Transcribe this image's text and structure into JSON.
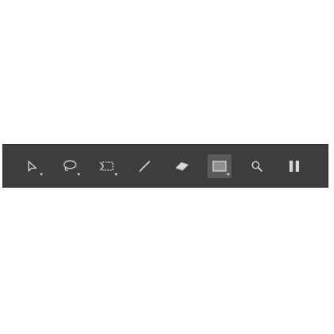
{
  "toolbar": {
    "tools": [
      {
        "id": "select",
        "icon": "arrow-select-icon",
        "has_submenu": true,
        "selected": false
      },
      {
        "id": "lasso",
        "icon": "lasso-icon",
        "has_submenu": true,
        "selected": false
      },
      {
        "id": "marquee",
        "icon": "marquee-select-icon",
        "has_submenu": true,
        "selected": false
      },
      {
        "id": "line",
        "icon": "line-icon",
        "has_submenu": false,
        "selected": false
      },
      {
        "id": "eraser",
        "icon": "eraser-icon",
        "has_submenu": false,
        "selected": false
      },
      {
        "id": "rectangle",
        "icon": "rectangle-icon",
        "has_submenu": true,
        "selected": true
      },
      {
        "id": "zoom",
        "icon": "magnifier-icon",
        "has_submenu": false,
        "selected": false
      },
      {
        "id": "pause",
        "icon": "pause-icon",
        "has_submenu": false,
        "selected": false
      }
    ],
    "colors": {
      "background": "#3d3d3d",
      "icon": "#d6d6d6",
      "selected_background": "#5a5a5a"
    }
  }
}
